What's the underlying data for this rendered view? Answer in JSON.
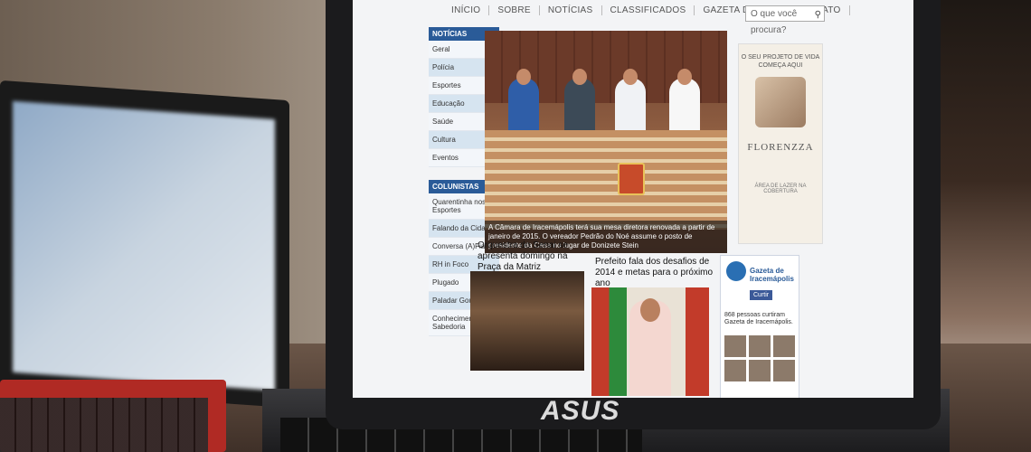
{
  "nav": [
    "INÍCIO",
    "SOBRE",
    "NOTÍCIAS",
    "CLASSIFICADOS",
    "GAZETA DIGITAL",
    "CONTATO"
  ],
  "search_placeholder": "O que você procura?",
  "sidebar": {
    "noticias_heading": "NOTÍCIAS",
    "noticias": [
      "Geral",
      "Polícia",
      "Esportes",
      "Educação",
      "Saúde",
      "Cultura",
      "Eventos"
    ],
    "colunistas_heading": "COLUNISTAS",
    "colunistas": [
      "Quarentinha nos Esportes",
      "Falando da Cidade",
      "Conversa (A)Fiada",
      "RH in Foco",
      "Plugado",
      "Paladar Gourmet",
      "Conhecimento & Sabedoria"
    ]
  },
  "hero_caption": "A Câmara de Iracemápolis terá sua mesa diretora renovada a partir de janeiro de 2015. O vereador Pedrão do Noé assume o posto de presidente da Casa no lugar de Donizete Stein",
  "ad": {
    "line1": "O SEU PROJETO DE VIDA COMEÇA AQUI",
    "brand": "FLORENZZA",
    "line2": "ÁREA DE LAZER NA COBERTURA"
  },
  "news1_title": "Orquestra do Senai se apresenta domingo na Praça da Matriz",
  "news2_title": "Prefeito fala dos desafios de 2014 e metas para o próximo ano",
  "facebook": {
    "page_name": "Gazeta de Iracemápolis",
    "like_label": "Curtir",
    "count_text": "868 pessoas curtiram Gazeta de Iracemápolis."
  },
  "brand_logo": "ASUS"
}
